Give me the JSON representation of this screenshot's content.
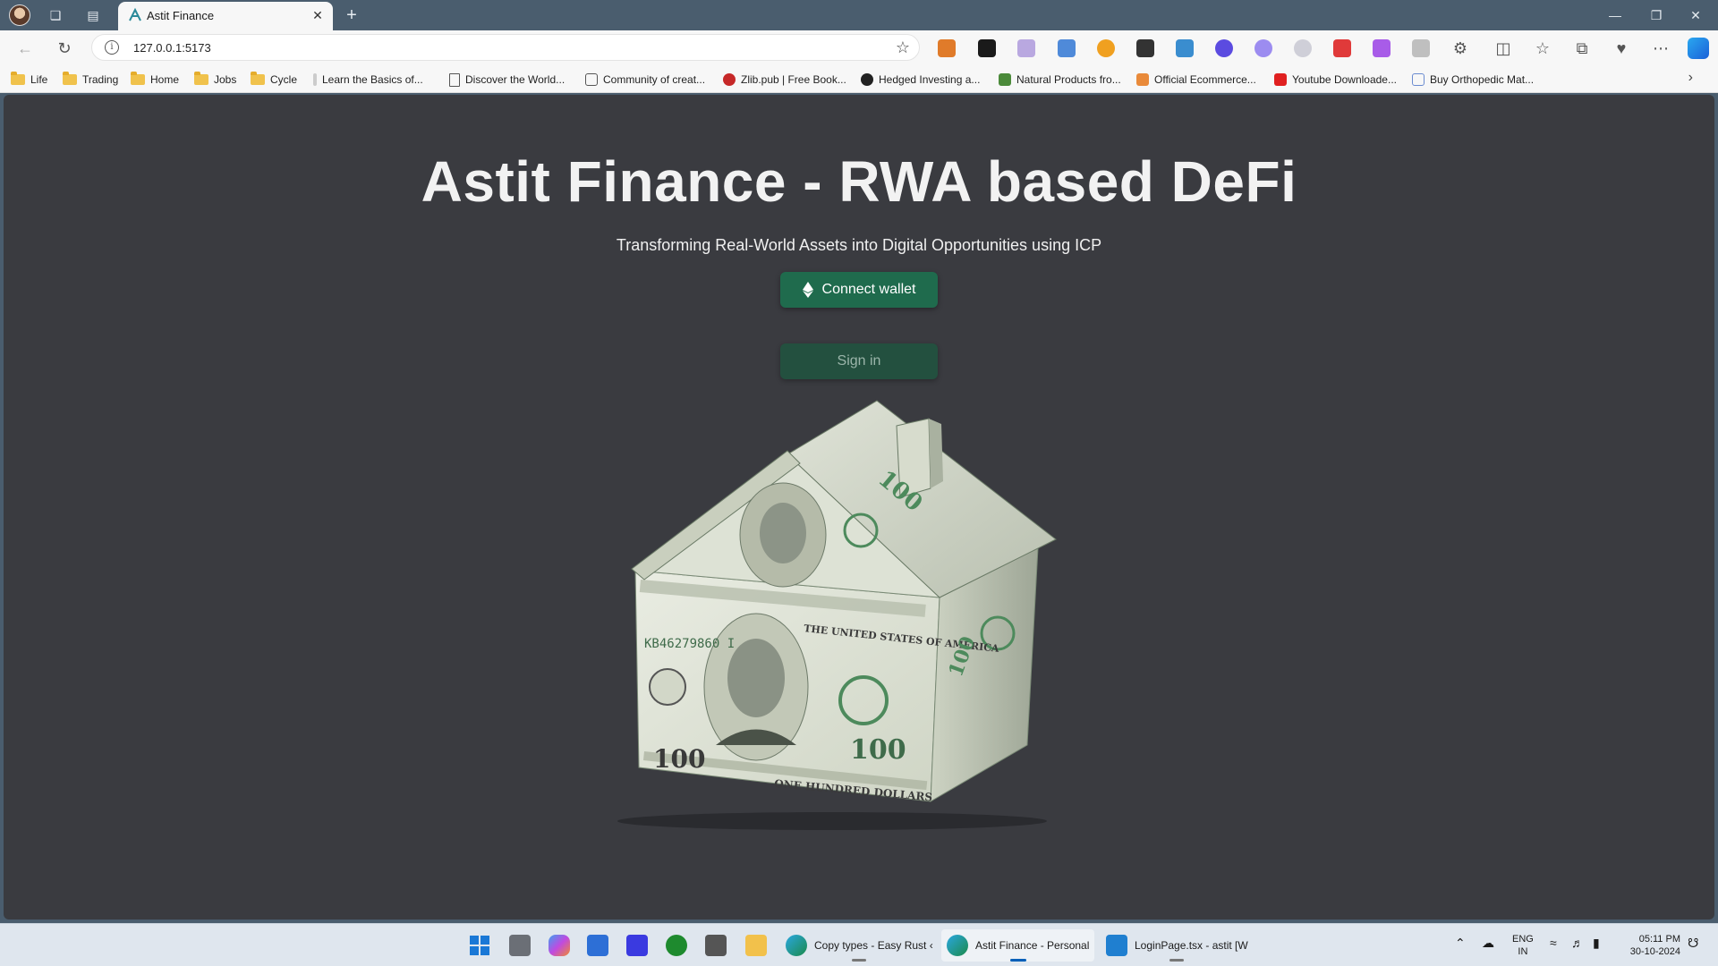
{
  "browser": {
    "tab_title": "Astit Finance",
    "url": "127.0.0.1:5173"
  },
  "bookmarks": [
    {
      "label": "Life",
      "icon": "folder-icon"
    },
    {
      "label": "Trading",
      "icon": "folder-icon"
    },
    {
      "label": "Home",
      "icon": "folder-icon"
    },
    {
      "label": "Jobs",
      "icon": "folder-icon"
    },
    {
      "label": "Cycle",
      "icon": "folder-icon"
    },
    {
      "label": "Learn the Basics of...",
      "icon": "site-icon"
    },
    {
      "label": "Discover the World...",
      "icon": "page-icon"
    },
    {
      "label": "Community of creat...",
      "icon": "site-icon"
    },
    {
      "label": "Zlib.pub | Free Book...",
      "icon": "site-icon"
    },
    {
      "label": "Hedged Investing a...",
      "icon": "site-icon"
    },
    {
      "label": "Natural Products fro...",
      "icon": "site-icon"
    },
    {
      "label": "Official Ecommerce...",
      "icon": "site-icon"
    },
    {
      "label": "Youtube Downloade...",
      "icon": "site-icon"
    },
    {
      "label": "Buy Orthopedic Mat...",
      "icon": "site-icon"
    }
  ],
  "page": {
    "title": "Astit Finance - RWA based DeFi",
    "subtitle": "Transforming Real-World Assets into Digital Opportunities using ICP",
    "connect_label": "Connect wallet",
    "signin_label": "Sign in",
    "bill_serial": "KB46279860 I",
    "bill_denomination": "100",
    "bill_caption": "ONE HUNDRED DOLLARS",
    "bill_country": "THE UNITED STATES OF AMERICA"
  },
  "taskbar": {
    "apps": [
      {
        "label": "Copy types - Easy Rust ‹"
      },
      {
        "label": "Astit Finance - Personal"
      },
      {
        "label": "LoginPage.tsx - astit [W"
      }
    ],
    "lang_top": "ENG",
    "lang_bottom": "IN",
    "time": "05:11 PM",
    "date": "30-10-2024"
  },
  "colors": {
    "page_bg": "#3a3b40",
    "button_primary": "#1f6b4d",
    "button_secondary": "#23503f",
    "bill_green": "#4d8a5c"
  }
}
